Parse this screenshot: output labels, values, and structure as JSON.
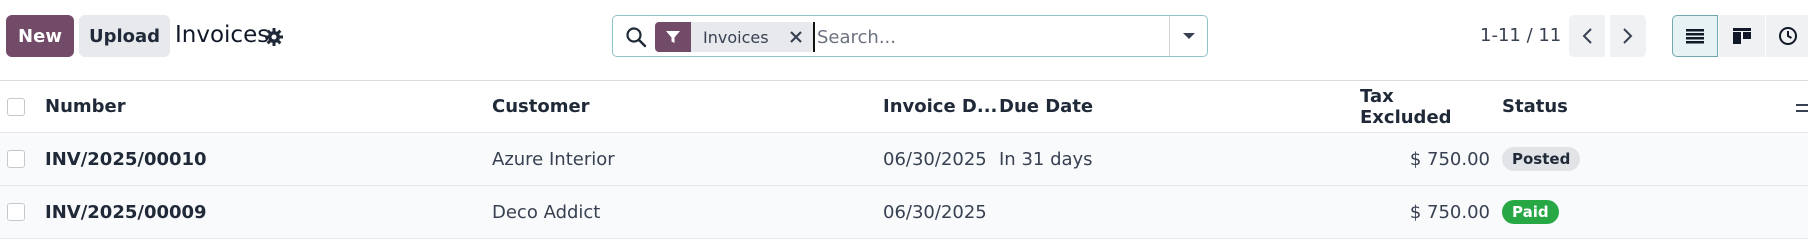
{
  "control_panel": {
    "new_label": "New",
    "upload_label": "Upload",
    "title": "Invoices",
    "search": {
      "facet_label": "Invoices",
      "placeholder": "Search..."
    },
    "pager": {
      "value": "1-11 / 11"
    }
  },
  "table": {
    "columns": {
      "number": "Number",
      "customer": "Customer",
      "invoice_date": "Invoice D...",
      "due_date": "Due Date",
      "tax_excluded": "Tax Excluded",
      "status": "Status"
    },
    "rows": [
      {
        "number": "INV/2025/00010",
        "customer": "Azure Interior",
        "invoice_date": "06/30/2025",
        "due_date": "In 31 days",
        "tax_excluded": "$ 750.00",
        "status": "Posted"
      },
      {
        "number": "INV/2025/00009",
        "customer": "Deco Addict",
        "invoice_date": "06/30/2025",
        "due_date": "",
        "tax_excluded": "$ 750.00",
        "status": "Paid"
      }
    ]
  },
  "colors": {
    "brand": "#714b67",
    "paid_badge": "#28a745",
    "posted_badge": "#e1e3e6"
  },
  "icons": [
    "gear-icon",
    "search-icon",
    "filter-icon",
    "close-icon",
    "caret-down-icon",
    "chevron-left-icon",
    "chevron-right-icon",
    "list-view-icon",
    "kanban-view-icon",
    "activity-view-icon",
    "column-settings-icon"
  ]
}
